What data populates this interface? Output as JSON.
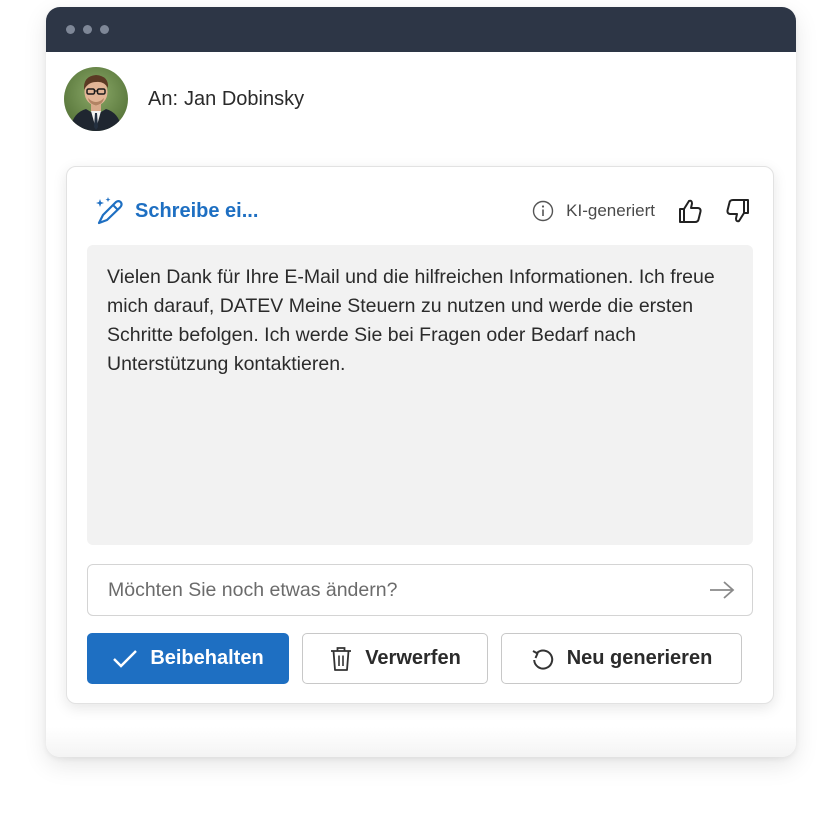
{
  "window": {
    "colors": {
      "titlebar": "#2d3646",
      "accent": "#1e6fc2"
    }
  },
  "recipient": {
    "prefix": "An:",
    "name": "Jan Dobinsky",
    "avatar_icon": "person-photo"
  },
  "assistant": {
    "title": "Schreibe ei...",
    "title_icon": "pen-sparkle-icon",
    "ai_label": "KI-generiert",
    "ai_icon": "info-icon",
    "feedback_icons": [
      "thumbs-up-icon",
      "thumbs-down-icon"
    ],
    "draft_text": "Vielen Dank für Ihre E-Mail und die hilfreichen Informationen. Ich freue mich darauf, DATEV Meine Steuern zu nutzen und werde die ersten Schritte befolgen. Ich werde Sie bei Fragen oder Bedarf nach Unterstützung kontaktieren.",
    "refine_placeholder": "Möchten Sie noch etwas ändern?",
    "send_icon": "arrow-right-icon"
  },
  "actions": {
    "keep_label": "Beibehalten",
    "discard_label": "Verwerfen",
    "regenerate_label": "Neu generieren"
  }
}
